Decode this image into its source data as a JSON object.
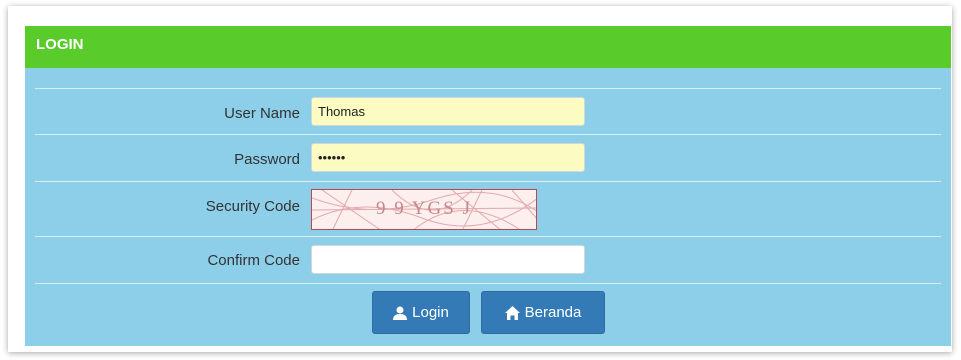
{
  "panel": {
    "title": "LOGIN"
  },
  "form": {
    "username": {
      "label": "User Name",
      "value": "Thomas"
    },
    "password": {
      "label": "Password",
      "value": "••••••"
    },
    "security": {
      "label": "Security Code",
      "captcha_text": "9 9 YGS J"
    },
    "confirm": {
      "label": "Confirm Code",
      "value": ""
    }
  },
  "buttons": {
    "login": {
      "label": "Login",
      "icon": "user-icon"
    },
    "beranda": {
      "label": "Beranda",
      "icon": "home-icon"
    }
  },
  "colors": {
    "header_green": "#59cc2b",
    "panel_blue": "#8dcfe9",
    "button_blue": "#337ab7",
    "input_yellow": "#fcfbc1"
  }
}
